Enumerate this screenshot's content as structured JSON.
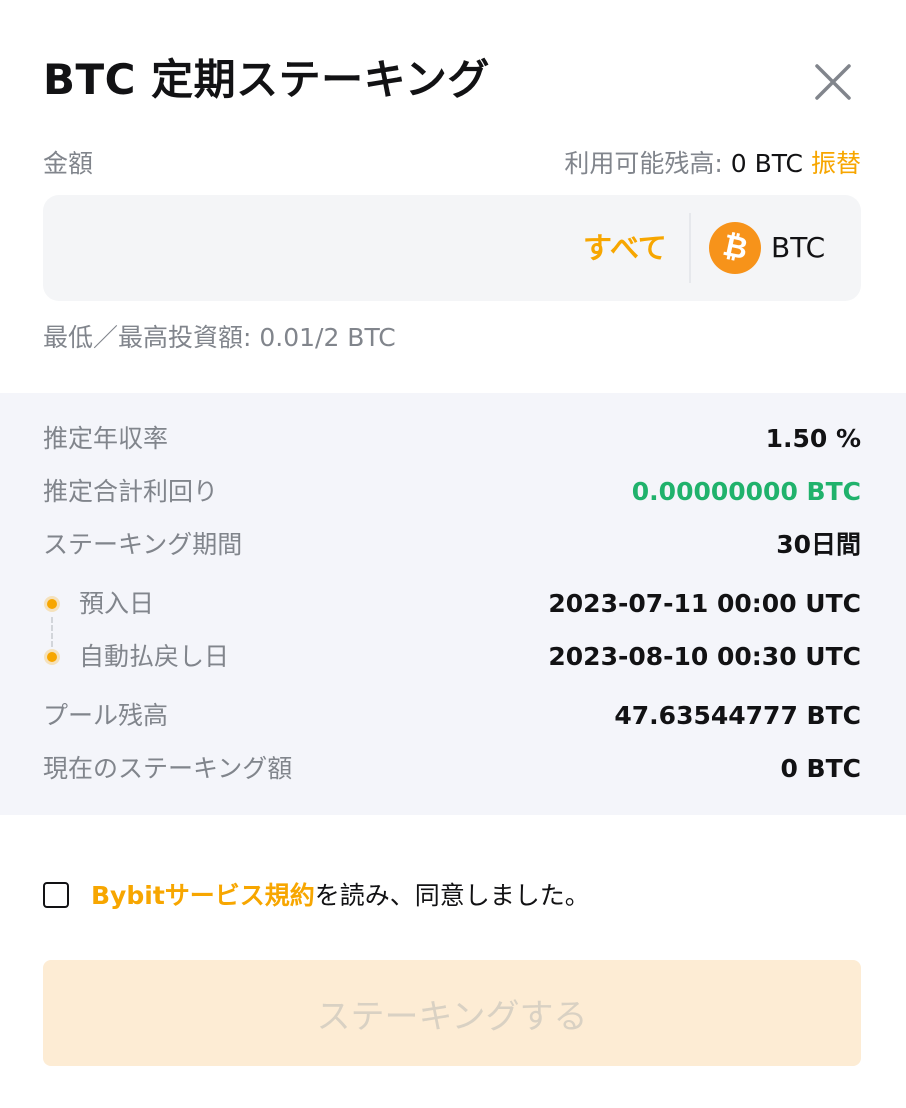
{
  "header": {
    "title": "BTC 定期ステーキング",
    "close_icon": "close-icon"
  },
  "amount": {
    "label": "金額",
    "balance_label": "利用可能残高: ",
    "balance_value": "0 BTC",
    "transfer_label": "振替",
    "input_value": "",
    "input_placeholder": "",
    "max_label": "すべて",
    "coin_icon": "bitcoin-icon",
    "coin_symbol": "₿",
    "coin_name": "BTC",
    "limit_text": "最低／最高投資額: 0.01/2 BTC"
  },
  "info": {
    "apr_label": "推定年収率",
    "apr_value": "1.50 %",
    "yield_label": "推定合計利回り",
    "yield_value": "0.00000000 BTC",
    "period_label": "ステーキング期間",
    "period_value": "30日間",
    "deposit_label": "預入日",
    "deposit_value": "2023-07-11 00:00 UTC",
    "redeem_label": "自動払戻し日",
    "redeem_value": "2023-08-10 00:30 UTC",
    "pool_label": "プール残高",
    "pool_value": "47.63544777 BTC",
    "current_label": "現在のステーキング額",
    "current_value": "0 BTC"
  },
  "agreement": {
    "terms_link": "Bybitサービス規約",
    "agree_suffix": "を読み、同意しました。",
    "checked": false
  },
  "submit": {
    "label": "ステーキングする",
    "enabled": false
  },
  "colors": {
    "accent": "#f7a600",
    "green": "#20b26c",
    "bitcoin": "#f7931a",
    "panel_bg": "#f4f5fa",
    "button_disabled_bg": "#fdecd4"
  }
}
